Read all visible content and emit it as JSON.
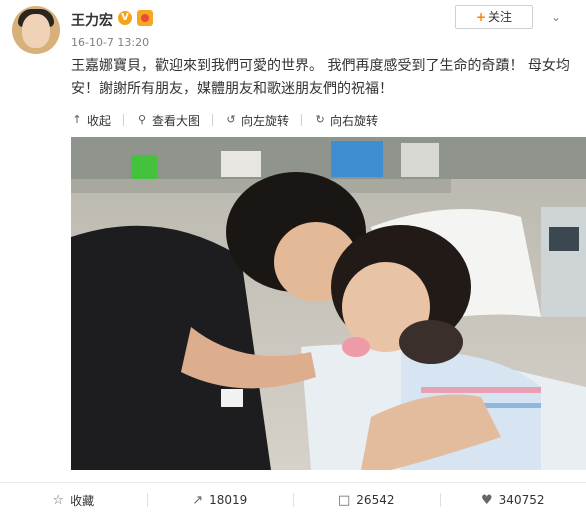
{
  "user": {
    "name": "王力宏",
    "verified_badge": "V",
    "timestamp": "16-10-7 13:20",
    "avatar_icon": "avatar-photo"
  },
  "follow_button": {
    "plus": "+",
    "label": "关注"
  },
  "menu_icon": "chevron-down-icon",
  "post": {
    "text": "王嘉娜寶貝，歡迎來到我們可愛的世界。 我們再度感受到了生命的奇蹟！ 母女均安！謝謝所有朋友，媒體朋友和歌迷朋友們的祝福！"
  },
  "toolbar": {
    "collapse": "收起",
    "view_large": "查看大图",
    "rotate_left": "向左旋转",
    "rotate_right": "向右旋转"
  },
  "actions": {
    "favorite": "收藏",
    "repost_count": "18019",
    "comment_count": "26542",
    "like_count": "340752"
  },
  "colors": {
    "accent": "#ff8200",
    "verified": "#f7a21b",
    "muted_text": "#808080"
  }
}
